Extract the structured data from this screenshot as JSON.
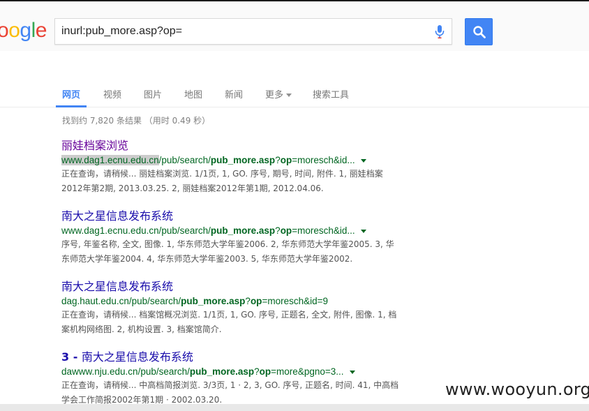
{
  "logo": {
    "letters": [
      {
        "ch": "o",
        "color": "#ea4335"
      },
      {
        "ch": "o",
        "color": "#fbbc05"
      },
      {
        "ch": "g",
        "color": "#4285f4"
      },
      {
        "ch": "l",
        "color": "#34a853"
      },
      {
        "ch": "e",
        "color": "#ea4335"
      }
    ]
  },
  "search": {
    "query": "inurl:pub_more.asp?op=",
    "mic_icon": "microphone-icon",
    "button_icon": "magnifier-icon"
  },
  "tabs": [
    {
      "label": "网页",
      "active": true
    },
    {
      "label": "视频",
      "active": false
    },
    {
      "label": "图片",
      "active": false
    },
    {
      "label": "地图",
      "active": false
    },
    {
      "label": "新闻",
      "active": false
    },
    {
      "label": "更多",
      "active": false
    },
    {
      "label": "搜索工具",
      "active": false
    }
  ],
  "stats": "找到约 7,820 条结果 （用时 0.49 秒）",
  "results": [
    {
      "title": "丽娃档案浏览",
      "url_parts": {
        "hl": "www.dag1.ecnu.edu.cn",
        "a": "/pub/search/",
        "b1": "pub_more.asp",
        "c": "?",
        "b2": "op",
        "d": "=moresch&id..."
      },
      "snippet_1": "正在查询，请稍候... 丽娃档案浏览. 1/1页, 1, GO. 序号, 期号, 时间, 附件. 1, 丽娃档案",
      "snippet_2": "2012年第2期, 2013.03.25. 2, 丽娃档案2012年第1期, 2012.04.06."
    },
    {
      "title": "南大之星信息发布系统",
      "url_parts": {
        "a": "www.dag1.ecnu.edu.cn/pub/search/",
        "b1": "pub_more.asp",
        "c": "?",
        "b2": "op",
        "d": "=moresch&id..."
      },
      "snippet_1": "序号, 年鉴名称, 全文, 图像. 1, 华东师范大学年鉴2006. 2, 华东师范大学年鉴2005. 3, 华",
      "snippet_2": "东师范大学年鉴2004. 4, 华东师范大学年鉴2003. 5, 华东师范大学年鉴2002."
    },
    {
      "title": "南大之星信息发布系统",
      "url_parts": {
        "a": "dag.haut.edu.cn/pub/search/",
        "b1": "pub_more.asp",
        "c": "?",
        "b2": "op",
        "d": "=moresch&id=9"
      },
      "snippet_1": "正在查询，请稍候... 档案馆概况浏览. 1/1页, 1, GO. 序号, 正题名, 全文, 附件, 图像. 1, 档",
      "snippet_2": "案机构网络图. 2, 机构设置. 3, 档案馆简介."
    },
    {
      "title_num": "3 - ",
      "title": "南大之星信息发布系统",
      "url_parts": {
        "a": "dawww.nju.edu.cn/pub/search/",
        "b1": "pub_more.asp",
        "c": "?",
        "b2": "op",
        "d": "=more&pgno=3..."
      },
      "snippet_1": "正在查询，请稍候... 中高档简报浏览. 3/3页, 1 · 2, 3, GO. 序号, 正题名, 时间. 41, 中高档",
      "snippet_2": "学会工作简报2002年第1期 · 2002.03.20."
    }
  ],
  "watermark": "www.wooyun.org"
}
